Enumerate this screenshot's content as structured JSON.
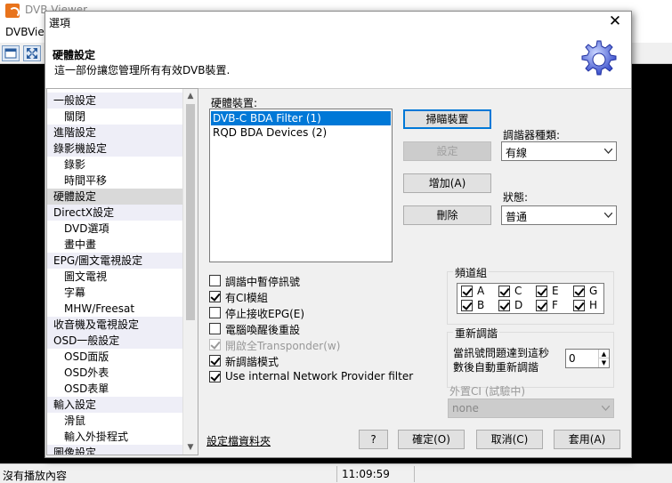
{
  "app": {
    "title": "DVB Viewer",
    "menu_label": "DVBView"
  },
  "dialog": {
    "title": "選項",
    "close_glyph": "✕",
    "header_title": "硬體設定",
    "header_desc": "這一部份讓您管理所有有效DVB裝置."
  },
  "tree": {
    "items": [
      {
        "label": "一般設定",
        "level": 0
      },
      {
        "label": "關閉",
        "level": 1
      },
      {
        "label": "進階設定",
        "level": 0
      },
      {
        "label": "錄影機設定",
        "level": 0
      },
      {
        "label": "錄影",
        "level": 1
      },
      {
        "label": "時間平移",
        "level": 1
      },
      {
        "label": "硬體設定",
        "level": 0,
        "selected": true
      },
      {
        "label": "DirectX設定",
        "level": 0
      },
      {
        "label": "DVD選項",
        "level": 1
      },
      {
        "label": "畫中畫",
        "level": 1
      },
      {
        "label": "EPG/圖文電視設定",
        "level": 0
      },
      {
        "label": "圖文電視",
        "level": 1
      },
      {
        "label": "字幕",
        "level": 1
      },
      {
        "label": "MHW/Freesat",
        "level": 1
      },
      {
        "label": "收音機及電視設定",
        "level": 0
      },
      {
        "label": "OSD一般設定",
        "level": 0
      },
      {
        "label": "OSD面版",
        "level": 1
      },
      {
        "label": "OSD外表",
        "level": 1
      },
      {
        "label": "OSD表單",
        "level": 1
      },
      {
        "label": "輸入設定",
        "level": 0
      },
      {
        "label": "滑鼠",
        "level": 1
      },
      {
        "label": "輸入外掛程式",
        "level": 1
      },
      {
        "label": "圖像設定",
        "level": 0
      }
    ]
  },
  "hardware": {
    "devices_label": "硬體裝置:",
    "devices": [
      "DVB-C BDA Filter (1)",
      "RQD BDA Devices (2)"
    ],
    "selected_device": 0,
    "scan_button": "掃瞄裝置",
    "settings_button": "設定",
    "add_button": "增加(A)",
    "remove_button": "刪除",
    "tuner_type_label": "調諧器種類:",
    "tuner_type_value": "有線",
    "state_label": "狀態:",
    "state_value": "普通"
  },
  "options": [
    {
      "label": "調諧中暫停訊號",
      "checked": false,
      "disabled": false
    },
    {
      "label": "有CI模組",
      "checked": true,
      "disabled": false
    },
    {
      "label": "停止接收EPG(E)",
      "checked": false,
      "disabled": false
    },
    {
      "label": "電腦喚醒後重設",
      "checked": false,
      "disabled": false
    },
    {
      "label": "開啟全Transponder(w)",
      "checked": true,
      "disabled": true
    },
    {
      "label": "新調諧模式",
      "checked": true,
      "disabled": false
    },
    {
      "label": "Use internal Network Provider filter",
      "checked": true,
      "disabled": false
    }
  ],
  "channel_group": {
    "title": "頻道組",
    "items": [
      {
        "label": "A",
        "checked": true
      },
      {
        "label": "C",
        "checked": true
      },
      {
        "label": "E",
        "checked": true
      },
      {
        "label": "G",
        "checked": true
      },
      {
        "label": "B",
        "checked": true
      },
      {
        "label": "D",
        "checked": true
      },
      {
        "label": "F",
        "checked": true
      },
      {
        "label": "H",
        "checked": true
      }
    ]
  },
  "retune": {
    "title": "重新調諧",
    "desc_line1": "當訊號問題達到這秒",
    "desc_line2": "數後自動重新調諧",
    "seconds": "0"
  },
  "external_ci": {
    "title": "外置CI (試驗中)",
    "value": "none"
  },
  "footer": {
    "config_link": "設定檔資料夾",
    "help_button": "?",
    "ok_button": "確定(O)",
    "cancel_button": "取消(C)",
    "apply_button": "套用(A)"
  },
  "status": {
    "text": "沒有播放內容",
    "time": "11:09:59"
  }
}
